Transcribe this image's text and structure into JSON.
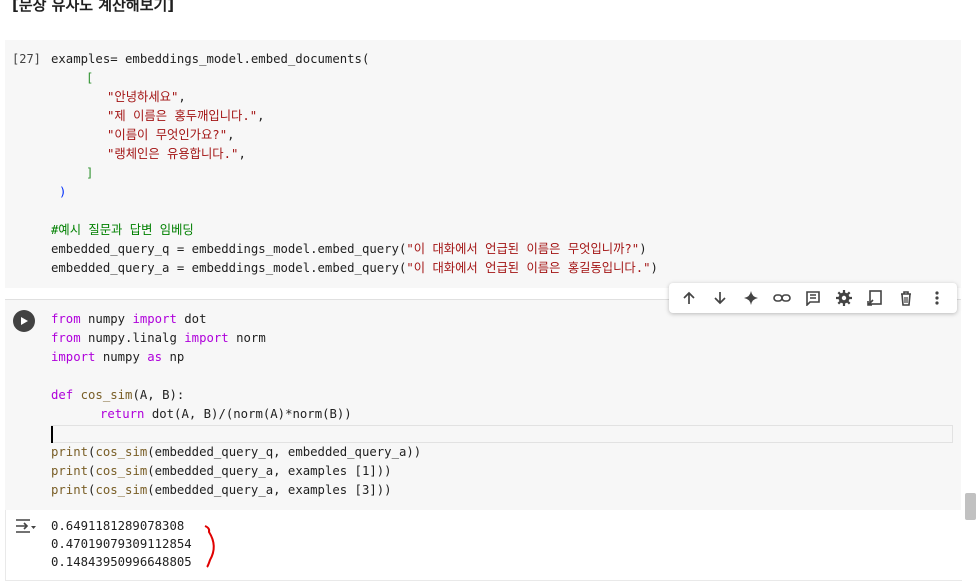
{
  "heading": "[문장 유사도 계산해보기]",
  "cell1": {
    "exec_count": "[27]",
    "lines": {
      "l1_a": "examples= embeddings_model.embed_documents(",
      "l2": "[",
      "s1": "\"안녕하세요\"",
      "s2": "\"제 이름은 홍두깨입니다.\"",
      "s3": "\"이름이 무엇인가요?\"",
      "s4": "\"랭체인은 유용합니다.\"",
      "comma": ",",
      "close_bracket": "]",
      "close_paren": ")",
      "comment": "#예시 질문과 답변 임베딩",
      "q_line_a": "embedded_query_q = embeddings_model.embed_query(",
      "q_str": "\"이 대화에서 언급된 이름은 무엇입니까?\"",
      "q_line_b": ")",
      "a_line_a": "embedded_query_a = embeddings_model.embed_query(",
      "a_str": "\"이 대화에서 언급된 이름은 홍길동입니다.\"",
      "a_line_b": ")"
    }
  },
  "cell2": {
    "code": {
      "kw_from": "from",
      "kw_import": "import",
      "kw_as": "as",
      "kw_def": "def",
      "kw_return": "return",
      "mod_numpy": " numpy ",
      "dot": " dot",
      "mod_linalg": " numpy.linalg ",
      "norm": " norm",
      "np": " np",
      "fn_name": " cos_sim",
      "def_args": "(A, B):",
      "return_expr": " dot(A, B)/(norm(A)*norm(B))",
      "p1_fn": "print",
      "p1_a": "(",
      "p1_fn2": "cos_sim",
      "p1_args": "(embedded_query_q, embedded_query_a))",
      "p2_args": "(embedded_query_a, examples [1]))",
      "p3_args": "(embedded_query_a, examples [3]))"
    },
    "toolbar": {
      "items": [
        "arrow-up-icon",
        "arrow-down-icon",
        "sparkle-icon",
        "link-icon",
        "comment-icon",
        "gear-icon",
        "mirror-cell-icon",
        "trash-icon",
        "more-vert-icon"
      ]
    },
    "output": [
      "0.6491181289078308",
      "0.47019079309112854",
      "0.14843950996648805"
    ]
  },
  "colors": {
    "keyword": "#af00db",
    "string": "#a31515",
    "comment": "#008000",
    "annotation": "#e00000"
  }
}
